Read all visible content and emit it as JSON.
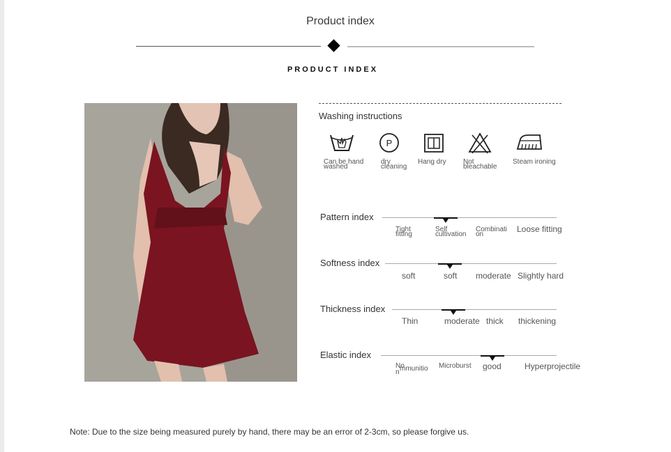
{
  "header": {
    "title": "Product index",
    "subtitle": "PRODUCT INDEX"
  },
  "washing": {
    "title": "Washing instructions",
    "items": [
      {
        "icon": "hand-wash-icon",
        "label_line1": "Can be hand",
        "label_line2": "washed"
      },
      {
        "icon": "dry-cleaning-icon",
        "label_line1": "dry",
        "label_line2": "cleaning"
      },
      {
        "icon": "hang-dry-icon",
        "label_line1": "Hang dry",
        "label_line2": ""
      },
      {
        "icon": "not-bleachable-icon",
        "label_line1": "Not",
        "label_line2": "bleachable"
      },
      {
        "icon": "steam-ironing-icon",
        "label_line1": "Steam ironing",
        "label_line2": ""
      }
    ]
  },
  "indices": {
    "pattern": {
      "title": "Pattern index",
      "opt1a": "Tight",
      "opt1b": "fitting",
      "opt2a": "Self",
      "opt2b": "cultivation",
      "opt3a": "Combinati",
      "opt3b": "on",
      "opt4": "Loose fitting",
      "selected": "Self cultivation"
    },
    "softness": {
      "title": "Softness index",
      "opt1": "soft",
      "opt2": "soft",
      "opt3": "moderate",
      "opt4": "Slightly hard",
      "selected": "soft"
    },
    "thickness": {
      "title": "Thickness index",
      "opt1": "Thin",
      "opt2": "moderate",
      "opt3": "thick",
      "opt4": "thickening",
      "selected": "moderate"
    },
    "elastic": {
      "title": "Elastic index",
      "opt1a": "No",
      "opt1b": "mmunitio",
      "opt1c": "n",
      "opt2": "Microburst",
      "opt3": "good",
      "opt4": "Hyperprojectile",
      "selected": "good"
    }
  },
  "note": "Note: Due to the size being measured purely by hand, there may be an error of 2-3cm, so please forgive us.",
  "colors": {
    "dress": "#7a1420",
    "accent": "#111111"
  }
}
